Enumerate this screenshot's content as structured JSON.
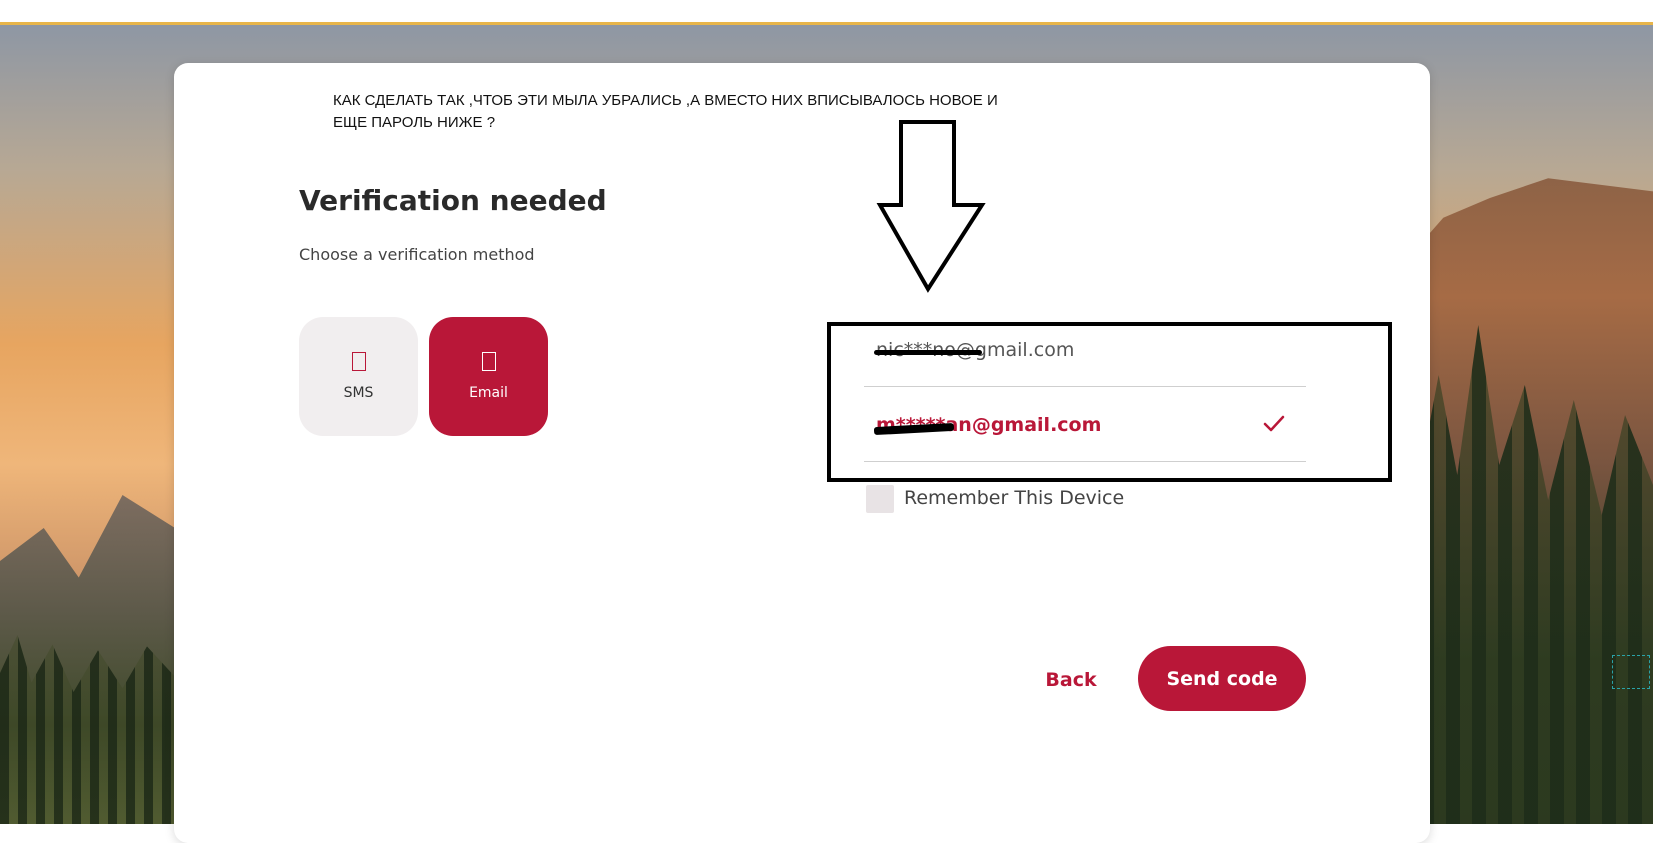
{
  "annotation": {
    "line1": "КАК СДЕЛАТЬ ТАК ,ЧТОБ ЭТИ МЫЛА УБРАЛИСЬ ,А ВМЕСТО НИХ ВПИСЫВАЛОСЬ НОВОЕ И",
    "line2": "ЕЩЕ  ПАРОЛЬ НИЖЕ ?"
  },
  "verification": {
    "title": "Verification needed",
    "subtitle": "Choose a verification method",
    "methods": [
      {
        "label": "SMS",
        "icon": "phone-icon",
        "selected": false
      },
      {
        "label": "Email",
        "icon": "mail-icon",
        "selected": true
      }
    ],
    "emails": [
      {
        "address": "nic***no@gmail.com",
        "selected": false
      },
      {
        "address": "m*****an@gmail.com",
        "selected": true
      }
    ],
    "selected_icon": "checkmark-icon",
    "remember_label": "Remember This Device",
    "back_label": "Back",
    "send_label": "Send code"
  },
  "colors": {
    "accent": "#b91738",
    "method_inactive_bg": "#f1eeef",
    "top_accent": "#e8b54a"
  }
}
